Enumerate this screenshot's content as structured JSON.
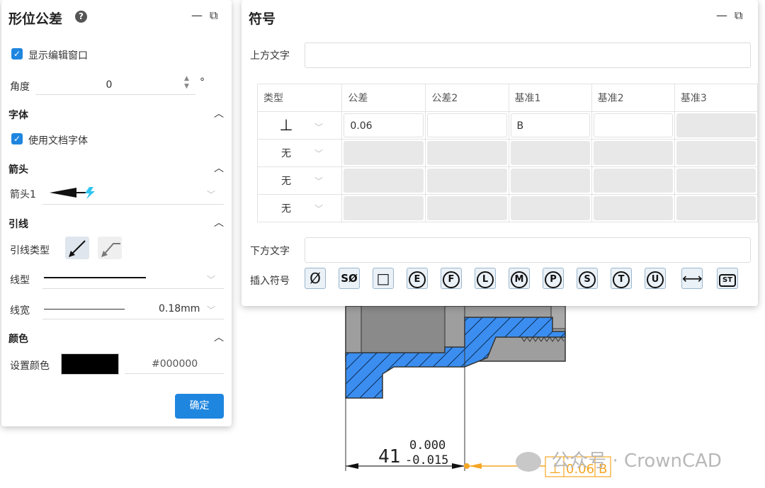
{
  "left_panel": {
    "title": "形位公差",
    "help_icon": "?",
    "show_edit_window": "显示编辑窗口",
    "angle_label": "角度",
    "angle_value": "0",
    "angle_unit": "°",
    "font_section": "字体",
    "use_doc_font": "使用文档字体",
    "arrow_section": "箭头",
    "arrow1_label": "箭头1",
    "leader_section": "引线",
    "leader_type_label": "引线类型",
    "line_type_label": "线型",
    "line_width_label": "线宽",
    "line_width_value": "0.18mm",
    "color_section": "颜色",
    "set_color_label": "设置颜色",
    "color_hex": "#000000",
    "color_swatch": "#000000",
    "ok_button": "确定"
  },
  "right_panel": {
    "title": "符号",
    "top_text_label": "上方文字",
    "bottom_text_label": "下方文字",
    "insert_symbol_label": "插入符号",
    "table": {
      "headers": [
        "类型",
        "公差",
        "公差2",
        "基准1",
        "基准2",
        "基准3"
      ],
      "rows": [
        {
          "type": "⊥",
          "tol": "0.06",
          "tol2": "",
          "d1": "B",
          "d2": "",
          "d3": ""
        },
        {
          "type": "无"
        },
        {
          "type": "无"
        },
        {
          "type": "无"
        }
      ]
    },
    "symbols": [
      "Ø",
      "SØ",
      "□",
      "E",
      "F",
      "L",
      "M",
      "P",
      "S",
      "T",
      "U",
      "⟷",
      "ST"
    ]
  },
  "drawing": {
    "dim_value": "41",
    "tol_upper": "0.000",
    "tol_lower": "-0.015",
    "fcf_symbol": "⊥",
    "fcf_tol": "0.06",
    "fcf_datum": "B"
  },
  "watermark": "公众号 · CrownCAD"
}
